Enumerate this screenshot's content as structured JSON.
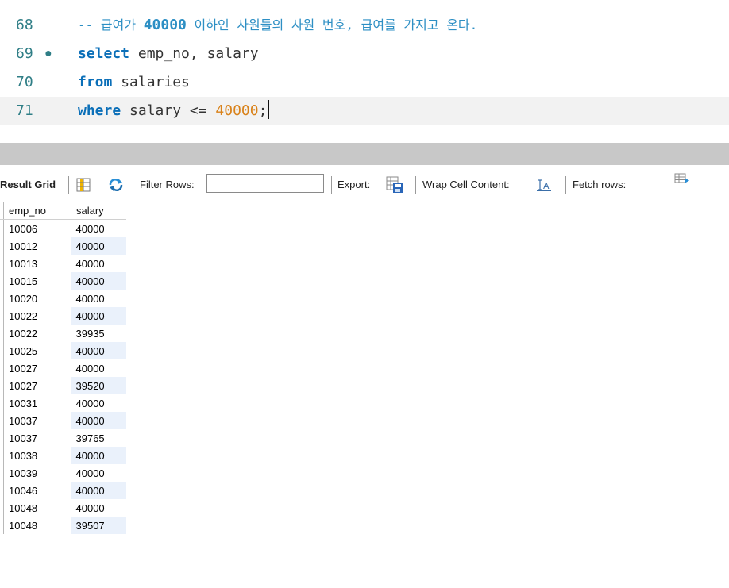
{
  "editor": {
    "lines": [
      {
        "number": "68",
        "marker": "",
        "comment_prefix": "-- 급여가 ",
        "comment_number": "40000",
        "comment_suffix": " 이하인 사원들의 사원 번호, 급여를 가지고 온다."
      },
      {
        "number": "69",
        "marker": "●",
        "keyword": "select",
        "rest": " emp_no, salary"
      },
      {
        "number": "70",
        "marker": "",
        "keyword": "from",
        "rest": " salaries"
      },
      {
        "number": "71",
        "marker": "",
        "keyword": "where",
        "rest": " salary <= ",
        "number_literal": "40000",
        "terminator": ";"
      }
    ]
  },
  "toolbar": {
    "result_grid_label": "Result Grid",
    "filter_rows_label": "Filter Rows:",
    "filter_value": "",
    "export_label": "Export:",
    "wrap_label": "Wrap Cell Content:",
    "fetch_label": "Fetch rows:"
  },
  "grid": {
    "columns": [
      "emp_no",
      "salary"
    ],
    "rows": [
      [
        "10006",
        "40000"
      ],
      [
        "10012",
        "40000"
      ],
      [
        "10013",
        "40000"
      ],
      [
        "10015",
        "40000"
      ],
      [
        "10020",
        "40000"
      ],
      [
        "10022",
        "40000"
      ],
      [
        "10022",
        "39935"
      ],
      [
        "10025",
        "40000"
      ],
      [
        "10027",
        "40000"
      ],
      [
        "10027",
        "39520"
      ],
      [
        "10031",
        "40000"
      ],
      [
        "10037",
        "40000"
      ],
      [
        "10037",
        "39765"
      ],
      [
        "10038",
        "40000"
      ],
      [
        "10039",
        "40000"
      ],
      [
        "10046",
        "40000"
      ],
      [
        "10048",
        "40000"
      ],
      [
        "10048",
        "39507"
      ]
    ]
  },
  "colors": {
    "keyword": "#0b6fb8",
    "number": "#d9821a",
    "comment": "#2d8fc4",
    "line_number": "#2f7e86",
    "alt_row": "#eaf1fb"
  }
}
